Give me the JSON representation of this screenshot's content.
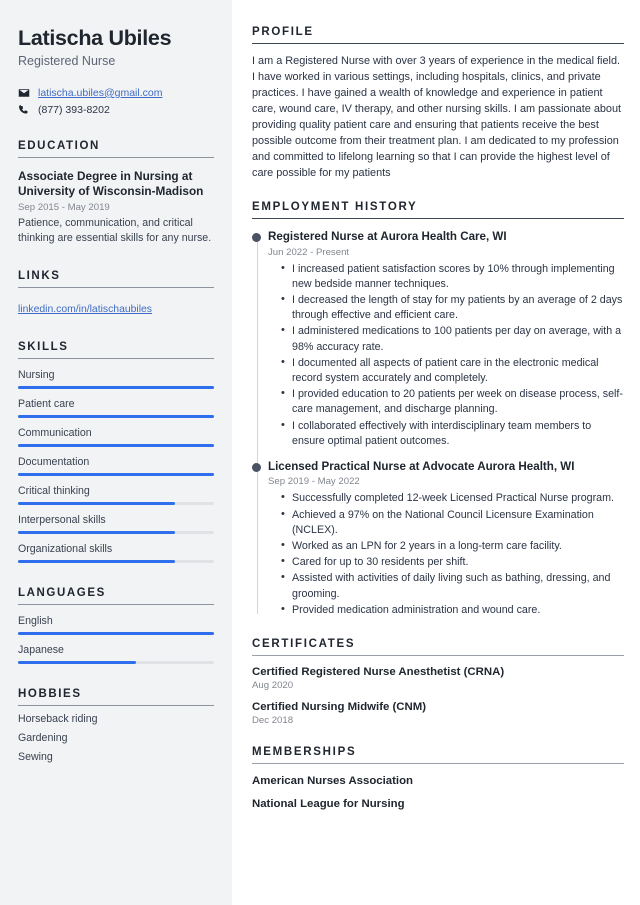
{
  "sidebar": {
    "name": "Latischa Ubiles",
    "job_title": "Registered Nurse",
    "contact": {
      "email": "latischa.ubiles@gmail.com",
      "email_icon": "envelope-icon",
      "phone": "(877) 393-8202",
      "phone_icon": "phone-icon"
    },
    "education": {
      "heading": "EDUCATION",
      "degree": "Associate Degree in Nursing at University of Wisconsin-Madison",
      "date": "Sep 2015 - May 2019",
      "description": "Patience, communication, and critical thinking are essential skills for any nurse."
    },
    "links": {
      "heading": "LINKS",
      "items": [
        {
          "label": "linkedin.com/in/latischaubiles"
        }
      ]
    },
    "skills": {
      "heading": "SKILLS",
      "items": [
        {
          "label": "Nursing",
          "level": 100
        },
        {
          "label": "Patient care",
          "level": 100
        },
        {
          "label": "Communication",
          "level": 100
        },
        {
          "label": "Documentation",
          "level": 100
        },
        {
          "label": "Critical thinking",
          "level": 80
        },
        {
          "label": "Interpersonal skills",
          "level": 80
        },
        {
          "label": "Organizational skills",
          "level": 80
        }
      ]
    },
    "languages": {
      "heading": "LANGUAGES",
      "items": [
        {
          "label": "English",
          "level": 100
        },
        {
          "label": "Japanese",
          "level": 60
        }
      ]
    },
    "hobbies": {
      "heading": "HOBBIES",
      "items": [
        {
          "label": "Horseback riding"
        },
        {
          "label": "Gardening"
        },
        {
          "label": "Sewing"
        }
      ]
    }
  },
  "main": {
    "profile": {
      "heading": "PROFILE",
      "text": "I am a Registered Nurse with over 3 years of experience in the medical field. I have worked in various settings, including hospitals, clinics, and private practices. I have gained a wealth of knowledge and experience in patient care, wound care, IV therapy, and other nursing skills. I am passionate about providing quality patient care and ensuring that patients receive the best possible outcome from their treatment plan. I am dedicated to my profession and committed to lifelong learning so that I can provide the highest level of care possible for my patients"
    },
    "employment": {
      "heading": "EMPLOYMENT HISTORY",
      "jobs": [
        {
          "title": "Registered Nurse at Aurora Health Care, WI",
          "date": "Jun 2022 - Present",
          "bullets": [
            "I increased patient satisfaction scores by 10% through implementing new bedside manner techniques.",
            "I decreased the length of stay for my patients by an average of 2 days through effective and efficient care.",
            "I administered medications to 100 patients per day on average, with a 98% accuracy rate.",
            "I documented all aspects of patient care in the electronic medical record system accurately and completely.",
            "I provided education to 20 patients per week on disease process, self-care management, and discharge planning.",
            "I collaborated effectively with interdisciplinary team members to ensure optimal patient outcomes."
          ]
        },
        {
          "title": "Licensed Practical Nurse at Advocate Aurora Health, WI",
          "date": "Sep 2019 - May 2022",
          "bullets": [
            "Successfully completed 12-week Licensed Practical Nurse program.",
            "Achieved a 97% on the National Council Licensure Examination (NCLEX).",
            "Worked as an LPN for 2 years in a long-term care facility.",
            "Cared for up to 30 residents per shift.",
            "Assisted with activities of daily living such as bathing, dressing, and grooming.",
            "Provided medication administration and wound care."
          ]
        }
      ]
    },
    "certificates": {
      "heading": "CERTIFICATES",
      "items": [
        {
          "name": "Certified Registered Nurse Anesthetist (CRNA)",
          "date": "Aug 2020"
        },
        {
          "name": "Certified Nursing Midwife (CNM)",
          "date": "Dec 2018"
        }
      ]
    },
    "memberships": {
      "heading": "MEMBERSHIPS",
      "items": [
        {
          "name": "American Nurses Association"
        },
        {
          "name": "National League for Nursing"
        }
      ]
    }
  },
  "theme": {
    "accent": "#2f6fed",
    "link": "#3f6bc4",
    "sidebar_bg": "#f2f3f5",
    "heading": "#20262f"
  }
}
